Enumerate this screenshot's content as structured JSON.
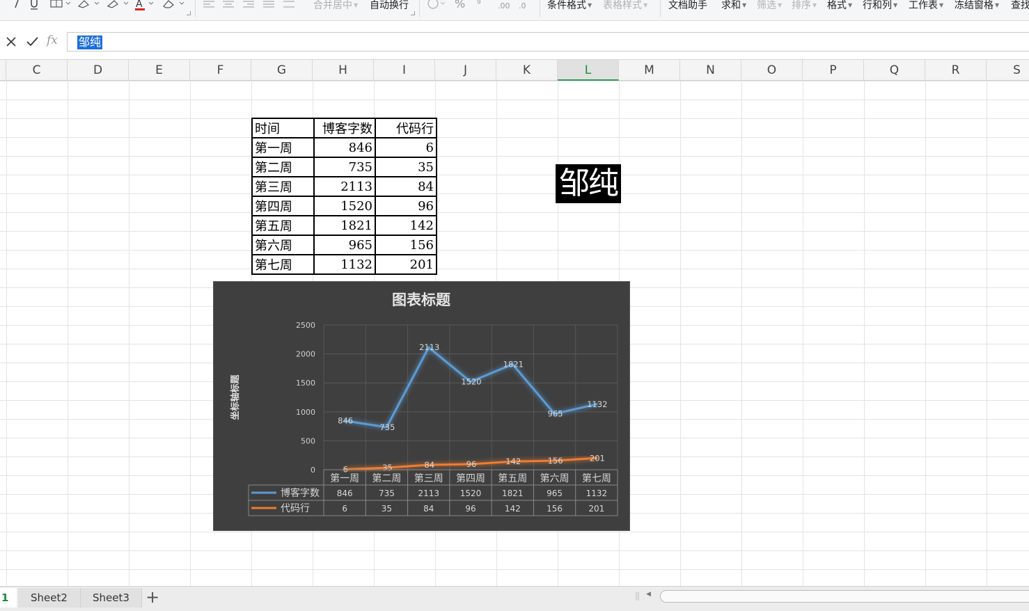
{
  "ribbon": {
    "merge_center": "合并居中",
    "wrap_text": "自动换行",
    "conditional_format": "条件格式",
    "table_style": "表格样式",
    "doc_assistant": "文档助手",
    "sum": "求和",
    "filter": "筛选",
    "sort": "排序",
    "format": "格式",
    "row_col": "行和列",
    "worksheet": "工作表",
    "freeze_panes": "冻结窗格",
    "find": "查找"
  },
  "formula_bar": {
    "fx_label": "fx",
    "value": "邹纯"
  },
  "columns": [
    "C",
    "D",
    "E",
    "F",
    "G",
    "H",
    "I",
    "J",
    "K",
    "L",
    "M",
    "N",
    "O",
    "P",
    "Q",
    "R",
    "S"
  ],
  "selected_column": "L",
  "table": {
    "header": [
      "时间",
      "博客字数",
      "代码行"
    ],
    "rows": [
      [
        "第一周",
        "846",
        "6"
      ],
      [
        "第二周",
        "735",
        "35"
      ],
      [
        "第三周",
        "2113",
        "84"
      ],
      [
        "第四周",
        "1520",
        "96"
      ],
      [
        "第五周",
        "1821",
        "142"
      ],
      [
        "第六周",
        "965",
        "156"
      ],
      [
        "第七周",
        "1132",
        "201"
      ]
    ]
  },
  "name_cell": "邹纯",
  "chart_data": {
    "type": "line",
    "title": "图表标题",
    "ylabel": "坐标轴标题",
    "xlabel": "",
    "ylim": [
      0,
      2500
    ],
    "yticks": [
      0,
      500,
      1000,
      1500,
      2000,
      2500
    ],
    "categories": [
      "第一周",
      "第二周",
      "第三周",
      "第四周",
      "第五周",
      "第六周",
      "第七周"
    ],
    "series": [
      {
        "name": "博客字数",
        "values": [
          846,
          735,
          2113,
          1520,
          1821,
          965,
          1132
        ],
        "color": "#5b9bd5"
      },
      {
        "name": "代码行",
        "values": [
          6,
          35,
          84,
          96,
          142,
          156,
          201
        ],
        "color": "#ed7d31"
      }
    ],
    "grid": true,
    "legend": "data-table",
    "data_labels": true
  },
  "sheets": {
    "active": "1",
    "tabs": [
      "Sheet2",
      "Sheet3"
    ],
    "add": "+"
  }
}
